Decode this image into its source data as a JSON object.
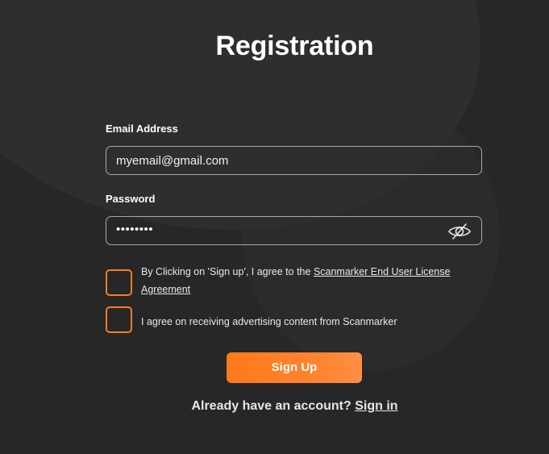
{
  "page": {
    "title": "Registration"
  },
  "form": {
    "email_label": "Email Address",
    "email_value": "myemail@gmail.com",
    "password_label": "Password",
    "password_value": "••••••••",
    "password_toggle_icon": "eye-slash-icon",
    "terms_checkbox": {
      "checked": false,
      "text_prefix": "By Clicking on 'Sign up', I agree to the ",
      "link_text": "Scanmarker End User License Agreement"
    },
    "ads_checkbox": {
      "checked": false,
      "text": "I agree on receiving advertising content from Scanmarker"
    },
    "signup_label": "Sign Up"
  },
  "footer": {
    "account_prompt": "Already have an account?",
    "signin_label": "Sign in"
  },
  "colors": {
    "background": "#272727",
    "accent": "#ff7a2b",
    "input_border": "#a9a9a9",
    "text": "#ffffff"
  }
}
